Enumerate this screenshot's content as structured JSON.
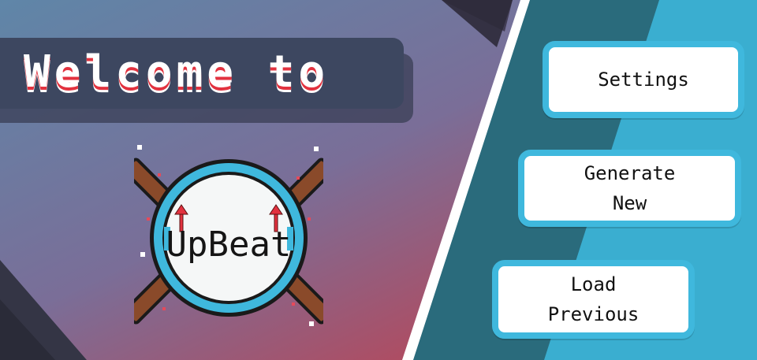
{
  "title": {
    "text": "Welcome to"
  },
  "logo": {
    "text": "UpBeat",
    "icon": "drum-logo-icon"
  },
  "menu": {
    "settings_label": "Settings",
    "generate_line1": "Generate",
    "generate_line2": "New",
    "load_line1": "Load",
    "load_line2": "Previous"
  },
  "colors": {
    "left_gradient_top": "#6c7d9a",
    "left_gradient_bottom": "#d4353c",
    "right_panel": "#3aaed0",
    "right_panel_dark": "#2a6b7c",
    "title_plate": "#3d4760",
    "title_underline": "#e2323f",
    "button_border": "#3fb8dd"
  }
}
